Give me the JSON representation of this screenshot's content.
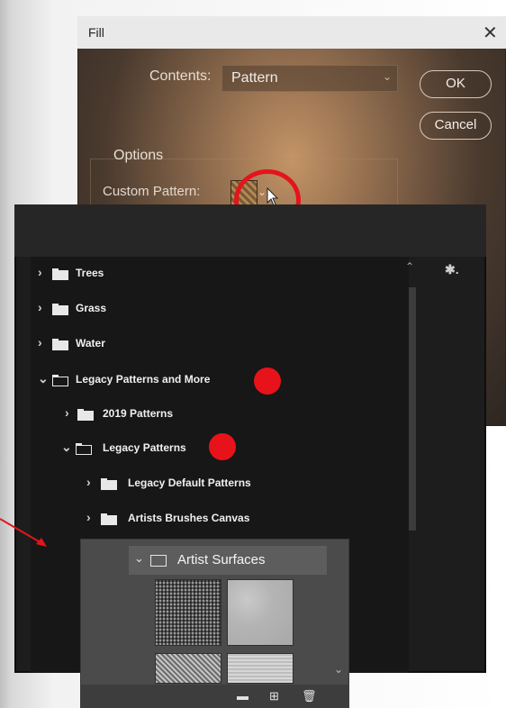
{
  "fill_dialog": {
    "title": "Fill",
    "close_glyph": "✕",
    "contents_label": "Contents:",
    "contents_value": "Pattern",
    "ok_label": "OK",
    "cancel_label": "Cancel",
    "options_label": "Options",
    "custom_pattern_label": "Custom Pattern:"
  },
  "pattern_tree": [
    {
      "label": "Trees",
      "expanded": false,
      "level": 0
    },
    {
      "label": "Grass",
      "expanded": false,
      "level": 0
    },
    {
      "label": "Water",
      "expanded": false,
      "level": 0
    },
    {
      "label": "Legacy Patterns and More",
      "expanded": true,
      "level": 0
    },
    {
      "label": "2019 Patterns",
      "expanded": false,
      "level": 1
    },
    {
      "label": "Legacy Patterns",
      "expanded": true,
      "level": 1
    },
    {
      "label": "Legacy Default Patterns",
      "expanded": false,
      "level": 2
    },
    {
      "label": "Artists Brushes Canvas",
      "expanded": false,
      "level": 2
    }
  ],
  "inset": {
    "folder_label": "Artist Surfaces",
    "footer_icons": [
      "folder-icon",
      "new-pattern-icon",
      "trash-icon"
    ]
  },
  "icons": {
    "gear": "gear-icon",
    "chevron_collapsed": "›",
    "chevron_expanded": "⌄"
  },
  "colors": {
    "annotation_red": "#e4141b",
    "panel_bg": "#1d1d1d",
    "inset_bg": "#4b4b4b"
  }
}
